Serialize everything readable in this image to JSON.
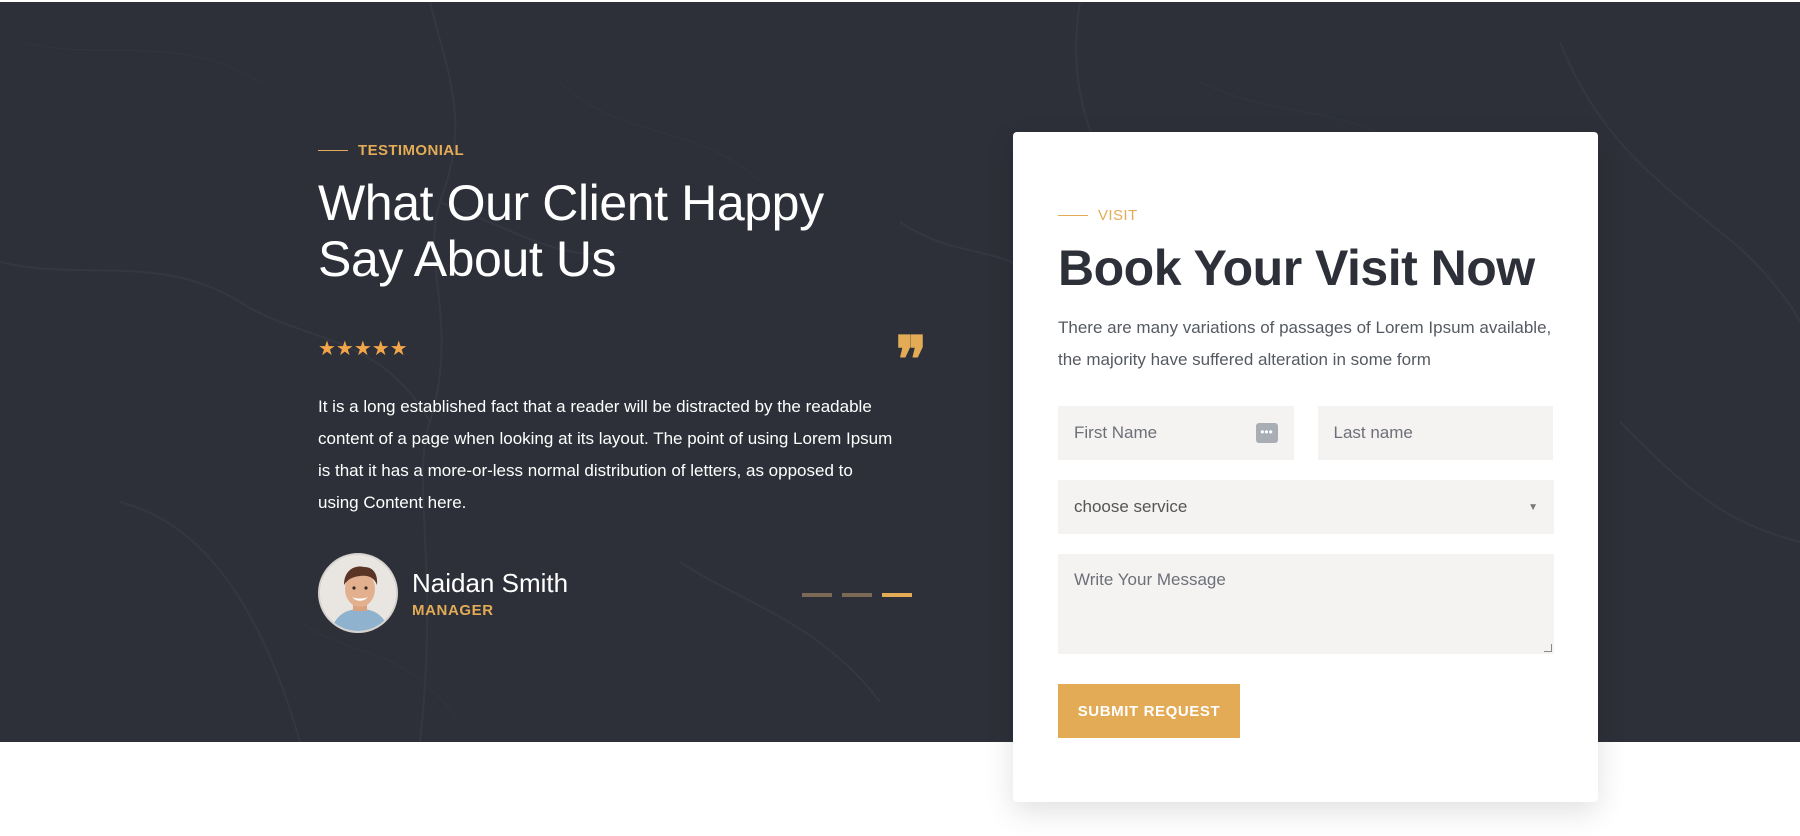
{
  "testimonial": {
    "eyebrow": "TESTIMONIAL",
    "heading_line1": "What Our Client Happy",
    "heading_line2": "Say About Us",
    "rating": 5,
    "stars": "★★★★★",
    "quote_icon": "quote-icon",
    "quote_glyph": "❞",
    "body": "It is a long established fact that a reader will be distracted by the readable content of a page when looking at its layout. The point of using Lorem Ipsum is that it has a more-or-less normal distribution of letters, as opposed to using Content here.",
    "person": {
      "name": "Naidan Smith",
      "role": "MANAGER"
    },
    "slides": {
      "count": 3,
      "active": 3
    }
  },
  "booking": {
    "eyebrow": "VISIT",
    "title": "Book Your Visit Now",
    "description": "There are many variations of passages of Lorem Ipsum available, the majority have suffered alteration in some form",
    "first_name_placeholder": "First Name",
    "last_name_placeholder": "Last name",
    "password_manager_icon": "password-manager-icon",
    "password_manager_glyph": "•••",
    "service_select_value": "choose service",
    "select_caret_glyph": "▼",
    "message_placeholder": "Write Your Message",
    "submit_label": "SUBMIT REQUEST"
  },
  "colors": {
    "accent": "#e3ab56",
    "dark_background": "#2d3038",
    "field_background": "#f4f3f2",
    "star": "#f3a549"
  }
}
